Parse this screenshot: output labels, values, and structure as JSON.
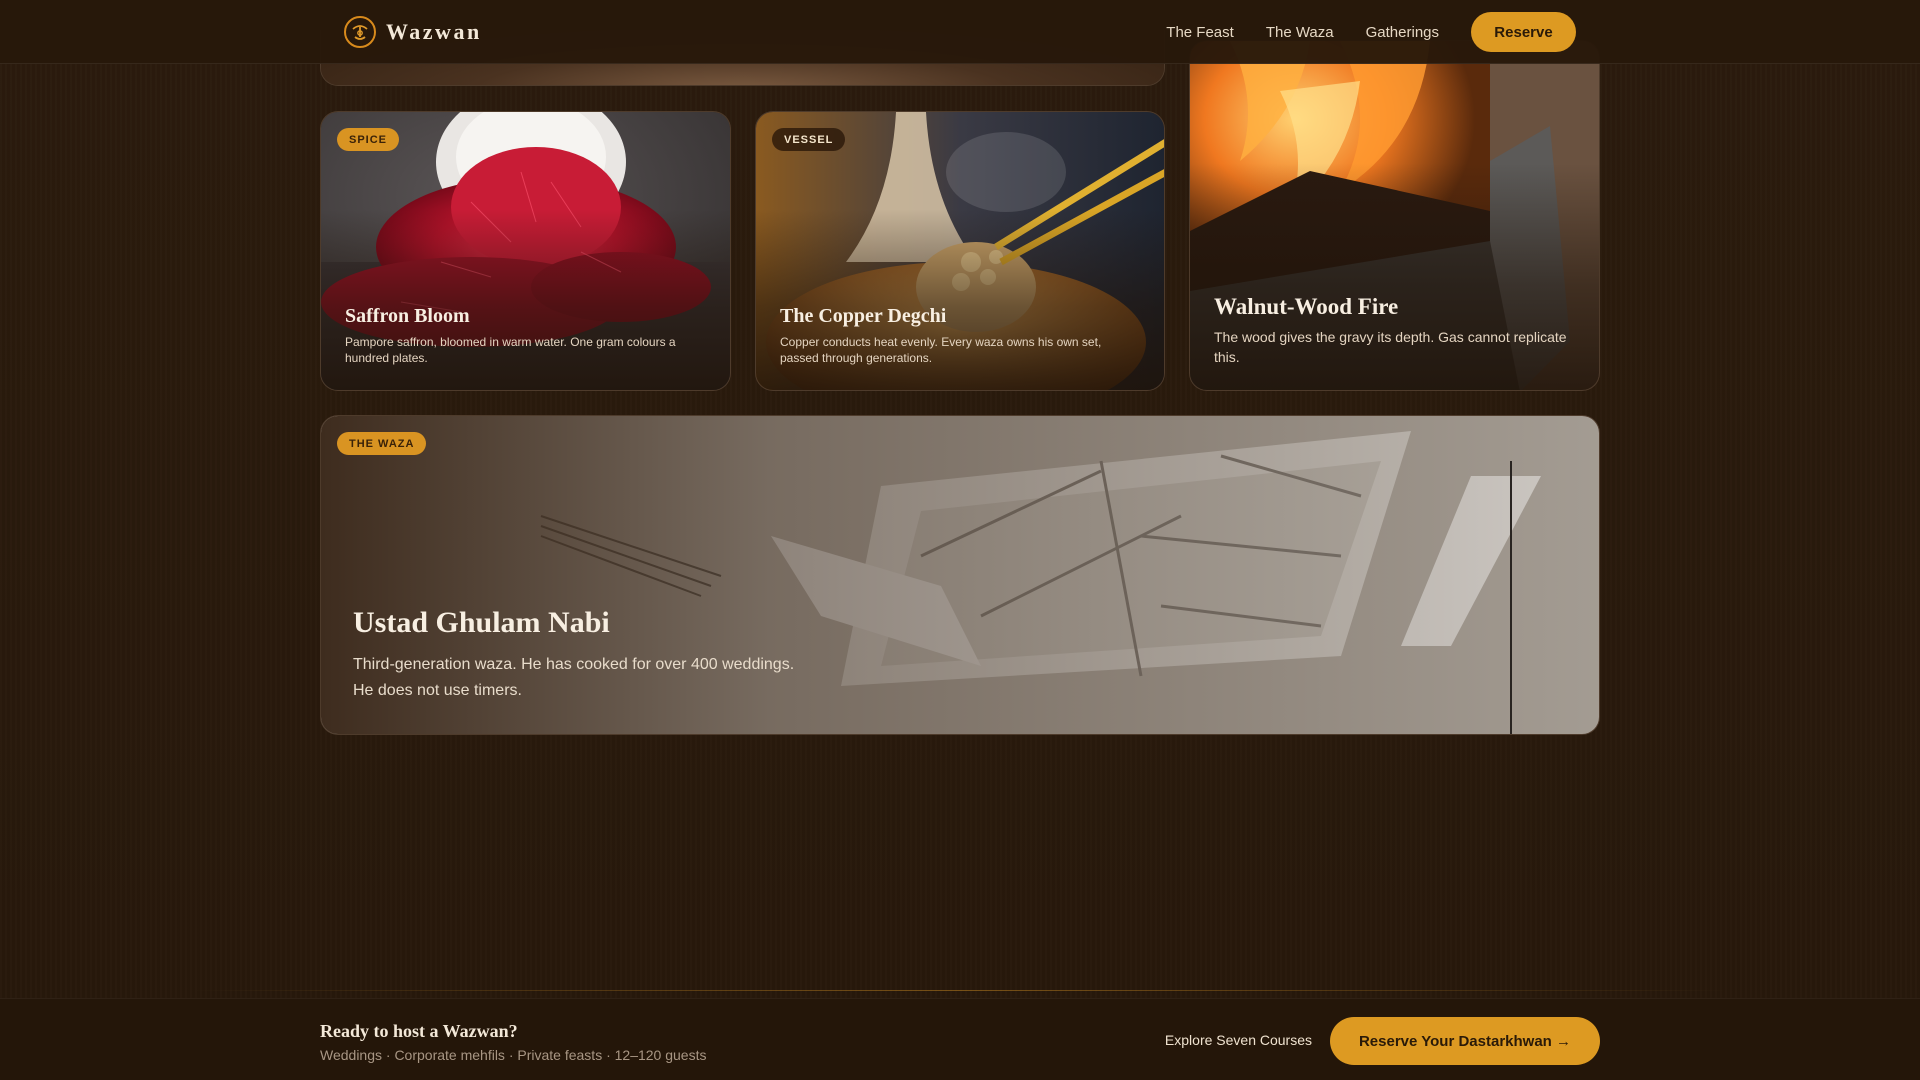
{
  "header": {
    "brand": "Wazwan",
    "nav": [
      "The Feast",
      "The Waza",
      "Gatherings"
    ],
    "reserve_label": "Reserve"
  },
  "cards": {
    "saffron": {
      "badge": "SPICE",
      "title": "Saffron Bloom",
      "desc": "Pampore saffron, bloomed in warm water. One gram colours a hundred plates."
    },
    "degchi": {
      "badge": "VESSEL",
      "title": "The Copper Degchi",
      "desc": "Copper conducts heat evenly. Every waza owns his own set, passed through generations."
    },
    "fire": {
      "title": "Walnut-Wood Fire",
      "desc": "The wood gives the gravy its depth. Gas cannot replicate this."
    },
    "waza": {
      "badge": "THE WAZA",
      "title": "Ustad Ghulam Nabi",
      "desc_line1": "Third-generation waza. He has cooked for over 400 weddings.",
      "desc_line2": "He does not use timers."
    }
  },
  "footer": {
    "title": "Ready to host a Wazwan?",
    "subtitle": "Weddings · Corporate mehfils · Private feasts · 12–120 guests",
    "explore_label": "Explore Seven Courses",
    "cta_label": "Reserve Your Dastarkhwan →"
  },
  "colors": {
    "background": "#2a1a0c",
    "accent": "#dd9a22",
    "text": "#f2e6d4"
  }
}
